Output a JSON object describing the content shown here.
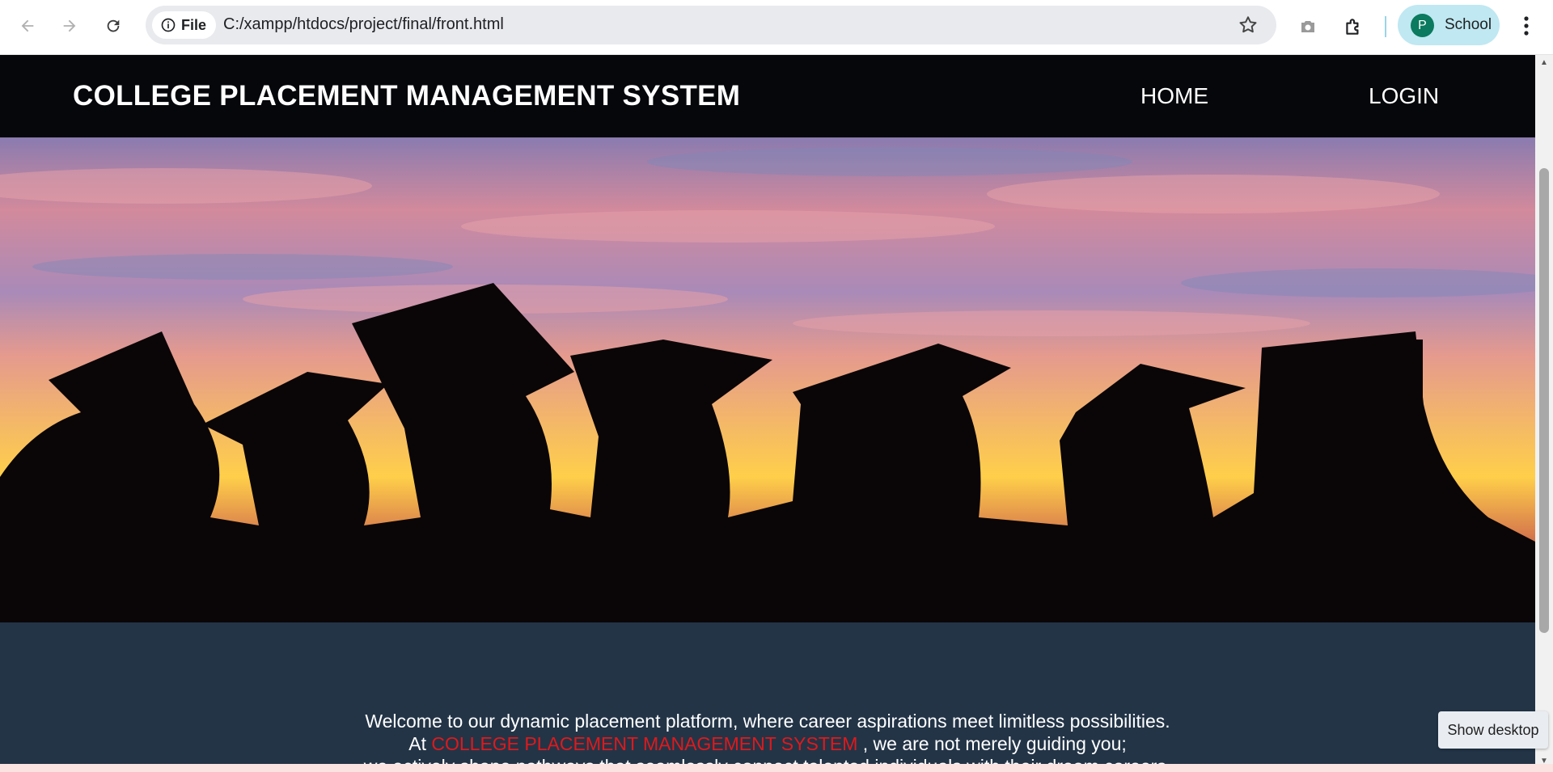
{
  "browser": {
    "file_label": "File",
    "url": "C:/xampp/htdocs/project/final/front.html",
    "profile_initial": "P",
    "profile_name": "School"
  },
  "site": {
    "title": "COLLEGE PLACEMENT MANAGEMENT SYSTEM",
    "nav": [
      "HOME",
      "LOGIN"
    ]
  },
  "hero": {
    "alt": "graduates-silhouette-sunset"
  },
  "welcome": {
    "line1": "Welcome to our dynamic placement platform, where career aspirations meet limitless possibilities.",
    "line2_prefix": "At",
    "line2_highlight": "COLLEGE PLACEMENT MANAGEMENT SYSTEM",
    "line2_suffix": ", we are not merely guiding you;",
    "line3": "we actively shape pathways that seamlessly connect talented individuals with their dream careers."
  },
  "taskbar": {
    "show_desktop": "Show desktop"
  },
  "colors": {
    "header_bg": "#05070b",
    "body_bg": "#233447",
    "highlight": "#e0191b"
  }
}
